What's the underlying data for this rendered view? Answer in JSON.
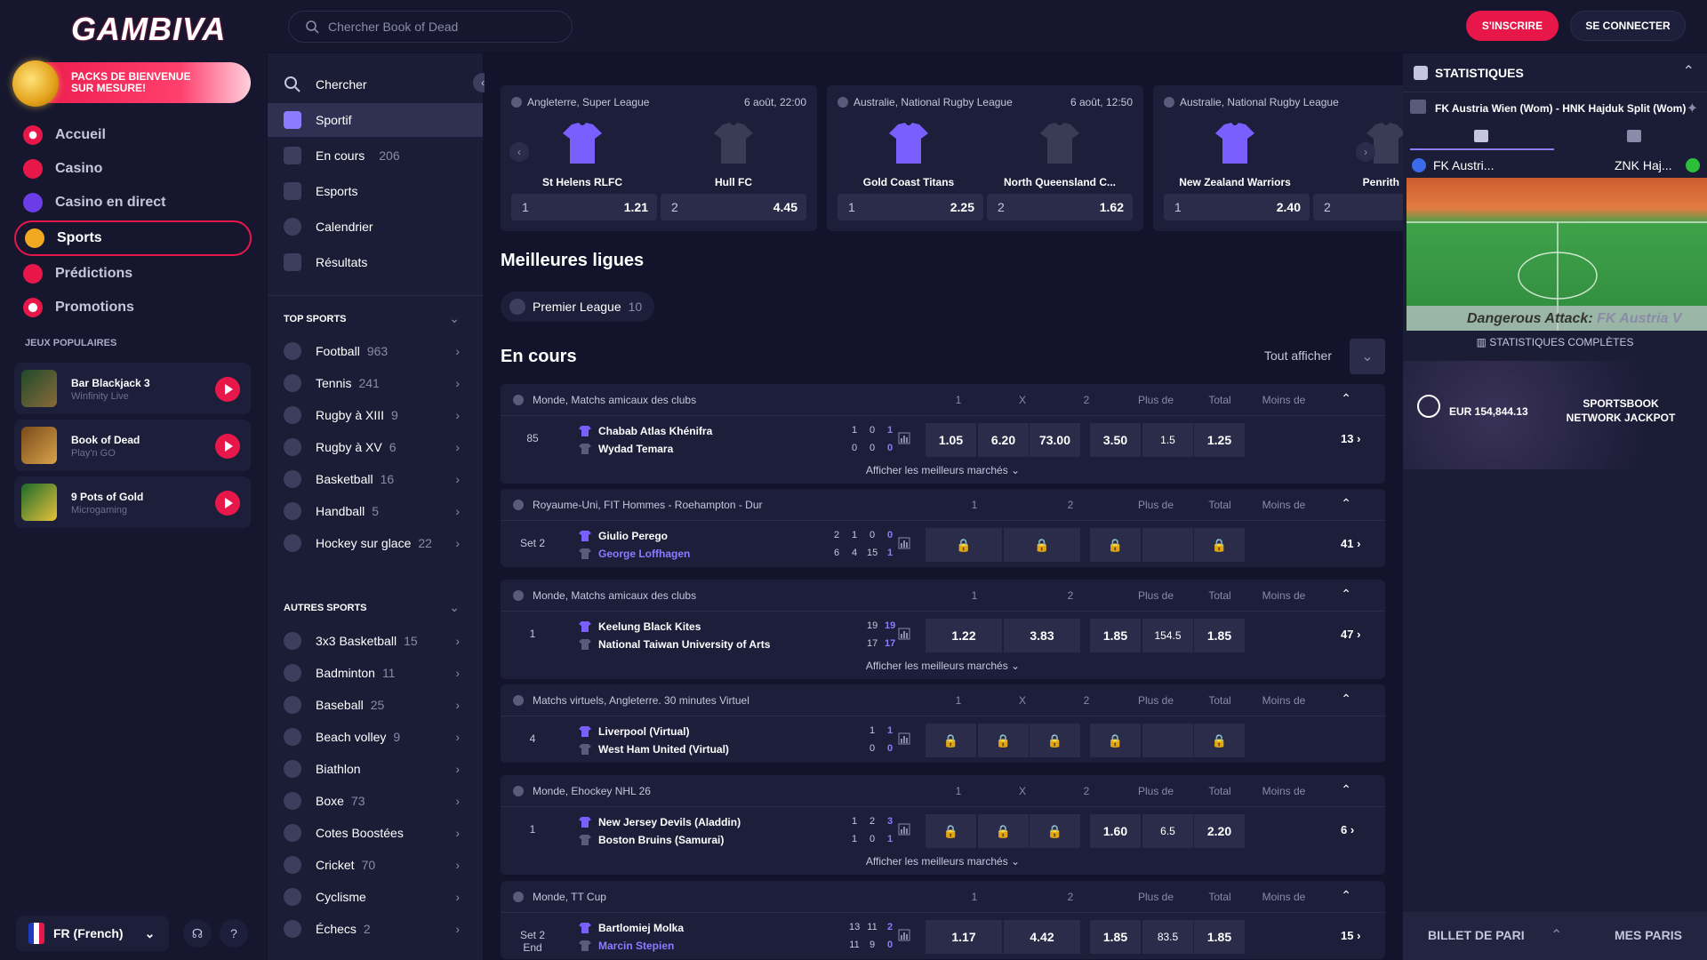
{
  "brand": {
    "name": "GAMBIVA"
  },
  "promo": {
    "text": "PACKS DE BIENVENUE SUR MESURE!"
  },
  "nav": [
    {
      "label": "Accueil",
      "icon": "home-icon"
    },
    {
      "label": "Casino",
      "icon": "casino-icon"
    },
    {
      "label": "Casino en direct",
      "icon": "live-casino-icon"
    },
    {
      "label": "Sports",
      "icon": "sports-icon",
      "active": true
    },
    {
      "label": "Prédictions",
      "icon": "predictions-icon"
    },
    {
      "label": "Promotions",
      "icon": "promotions-icon"
    }
  ],
  "popular": {
    "title": "JEUX POPULAIRES",
    "games": [
      {
        "name": "Bar Blackjack 3",
        "provider": "Winfinity Live"
      },
      {
        "name": "Book of Dead",
        "provider": "Play'n GO"
      },
      {
        "name": "9 Pots of Gold",
        "provider": "Microgaming"
      }
    ]
  },
  "language": {
    "label": "FR (French)"
  },
  "topbar": {
    "search_placeholder": "Chercher Book of Dead",
    "signup": "S'INSCRIRE",
    "login": "SE CONNECTER"
  },
  "sports_menu": {
    "items": [
      {
        "label": "Chercher",
        "count": ""
      },
      {
        "label": "Sportif",
        "count": "",
        "active": true
      },
      {
        "label": "En cours",
        "count": "206"
      },
      {
        "label": "Esports",
        "count": ""
      },
      {
        "label": "Calendrier",
        "count": ""
      },
      {
        "label": "Résultats",
        "count": ""
      }
    ],
    "top_title": "TOP SPORTS",
    "top": [
      {
        "label": "Football",
        "count": "963"
      },
      {
        "label": "Tennis",
        "count": "241"
      },
      {
        "label": "Rugby à XIII",
        "count": "9"
      },
      {
        "label": "Rugby à XV",
        "count": "6"
      },
      {
        "label": "Basketball",
        "count": "16"
      },
      {
        "label": "Handball",
        "count": "5"
      },
      {
        "label": "Hockey sur glace",
        "count": "22"
      }
    ],
    "other_title": "AUTRES SPORTS",
    "other": [
      {
        "label": "3x3 Basketball",
        "count": "15"
      },
      {
        "label": "Badminton",
        "count": "11"
      },
      {
        "label": "Baseball",
        "count": "25"
      },
      {
        "label": "Beach volley",
        "count": "9"
      },
      {
        "label": "Biathlon",
        "count": ""
      },
      {
        "label": "Boxe",
        "count": "73"
      },
      {
        "label": "Cotes Boostées",
        "count": ""
      },
      {
        "label": "Cricket",
        "count": "70"
      },
      {
        "label": "Cyclisme",
        "count": ""
      },
      {
        "label": "Échecs",
        "count": "2"
      }
    ]
  },
  "featured": [
    {
      "league": "Angleterre, Super League",
      "date": "6 août, 22:00",
      "home": "St Helens RLFC",
      "away": "Hull FC",
      "o1k": "1",
      "o1": "1.21",
      "o2k": "2",
      "o2": "4.45"
    },
    {
      "league": "Australie, National Rugby League",
      "date": "6 août, 12:50",
      "home": "Gold Coast Titans",
      "away": "North Queensland C...",
      "o1k": "1",
      "o1": "2.25",
      "o2k": "2",
      "o2": "1.62"
    },
    {
      "league": "Australie, National Rugby League",
      "date": "",
      "home": "New Zealand Warriors",
      "away": "Penrith P",
      "o1k": "1",
      "o1": "2.40",
      "o2k": "2",
      "o2": ""
    }
  ],
  "best_leagues": {
    "title": "Meilleures ligues",
    "chip": "Premier League",
    "chip_count": "10"
  },
  "live": {
    "title": "En cours",
    "show_all": "Tout afficher"
  },
  "colhead": {
    "c1": "1",
    "cx": "X",
    "c2": "2",
    "over": "Plus de",
    "total": "Total",
    "under": "Moins de"
  },
  "show_best": "Afficher les meilleurs marchés",
  "leagues": [
    {
      "name": "Monde, Matchs amicaux des clubs",
      "three": true,
      "minute": "85",
      "home": "Chabab Atlas Khénifra",
      "away": "Wydad Temara",
      "away_blue": false,
      "s1": [
        "1",
        "0",
        "1"
      ],
      "s2": [
        "0",
        "0",
        "0"
      ],
      "odds": [
        "1.05",
        "6.20",
        "73.00"
      ],
      "ou": [
        "3.50",
        "1.5",
        "1.25"
      ],
      "more": "13",
      "show_more": true
    },
    {
      "name": "Royaume-Uni, FIT Hommes - Roehampton - Dur",
      "three": false,
      "minute": "Set 2",
      "home": "Giulio Perego",
      "away": "George Loffhagen",
      "away_blue": true,
      "s1": [
        "2",
        "1",
        "0",
        "0"
      ],
      "s2": [
        "6",
        "4",
        "15",
        "1"
      ],
      "odds": [
        "",
        "",
        ""
      ],
      "ou": [
        "",
        "",
        ""
      ],
      "more": "41",
      "show_more": false
    },
    {
      "name": "Monde, Matchs amicaux des clubs",
      "three": false,
      "minute": "1",
      "home": "Keelung Black Kites",
      "away": "National Taiwan University of Arts",
      "away_blue": false,
      "s1": [
        "19",
        "19"
      ],
      "s2": [
        "17",
        "17"
      ],
      "odds": [
        "1.22",
        "3.83",
        ""
      ],
      "ou": [
        "1.85",
        "154.5",
        "1.85"
      ],
      "more": "47",
      "show_more": true
    },
    {
      "name": "Matchs virtuels, Angleterre. 30 minutes Virtuel",
      "three": true,
      "minute": "4",
      "home": "Liverpool (Virtual)",
      "away": "West Ham United (Virtual)",
      "away_blue": false,
      "s1": [
        "1",
        "1"
      ],
      "s2": [
        "0",
        "0"
      ],
      "odds": [
        "",
        "",
        ""
      ],
      "ou": [
        "",
        "",
        ""
      ],
      "more": "",
      "show_more": false
    },
    {
      "name": "Monde, Ehockey NHL 26",
      "three": true,
      "minute": "1",
      "home": "New Jersey Devils (Aladdin)",
      "away": "Boston Bruins (Samurai)",
      "away_blue": false,
      "s1": [
        "1",
        "2",
        "3"
      ],
      "s2": [
        "1",
        "0",
        "1"
      ],
      "odds": [
        "",
        "",
        ""
      ],
      "ou": [
        "1.60",
        "6.5",
        "2.20"
      ],
      "more": "6",
      "show_more": true
    },
    {
      "name": "Monde, TT Cup",
      "three": false,
      "minute": "Set 2 End",
      "home": "Bartlomiej Molka",
      "away": "Marcin Stepien",
      "away_blue": true,
      "s1": [
        "13",
        "11",
        "2"
      ],
      "s2": [
        "11",
        "9",
        "0"
      ],
      "odds": [
        "1.17",
        "4.42",
        ""
      ],
      "ou": [
        "1.85",
        "83.5",
        "1.85"
      ],
      "more": "15",
      "show_more": false
    }
  ],
  "right": {
    "title": "STATISTIQUES",
    "match": "FK Austria Wien (Wom) - HNK Hajduk Split (Wom)",
    "home_short": "FK Austri...",
    "away_short": "ZNK Haj...",
    "attack": "Dangerous Attack:",
    "attack_team": "FK Austria V",
    "full_stats": "STATISTIQUES COMPLÈTES",
    "jackpot_amount": "EUR 154,844.13",
    "jackpot_label": "SPORTSBOOK NETWORK JACKPOT",
    "betslip": "BILLET DE PARI",
    "mybets": "MES PARIS"
  },
  "colors": {
    "accent": "#e8174a",
    "purple": "#8c7bff",
    "bg": "#13142b",
    "panel": "#1d1e3a"
  }
}
